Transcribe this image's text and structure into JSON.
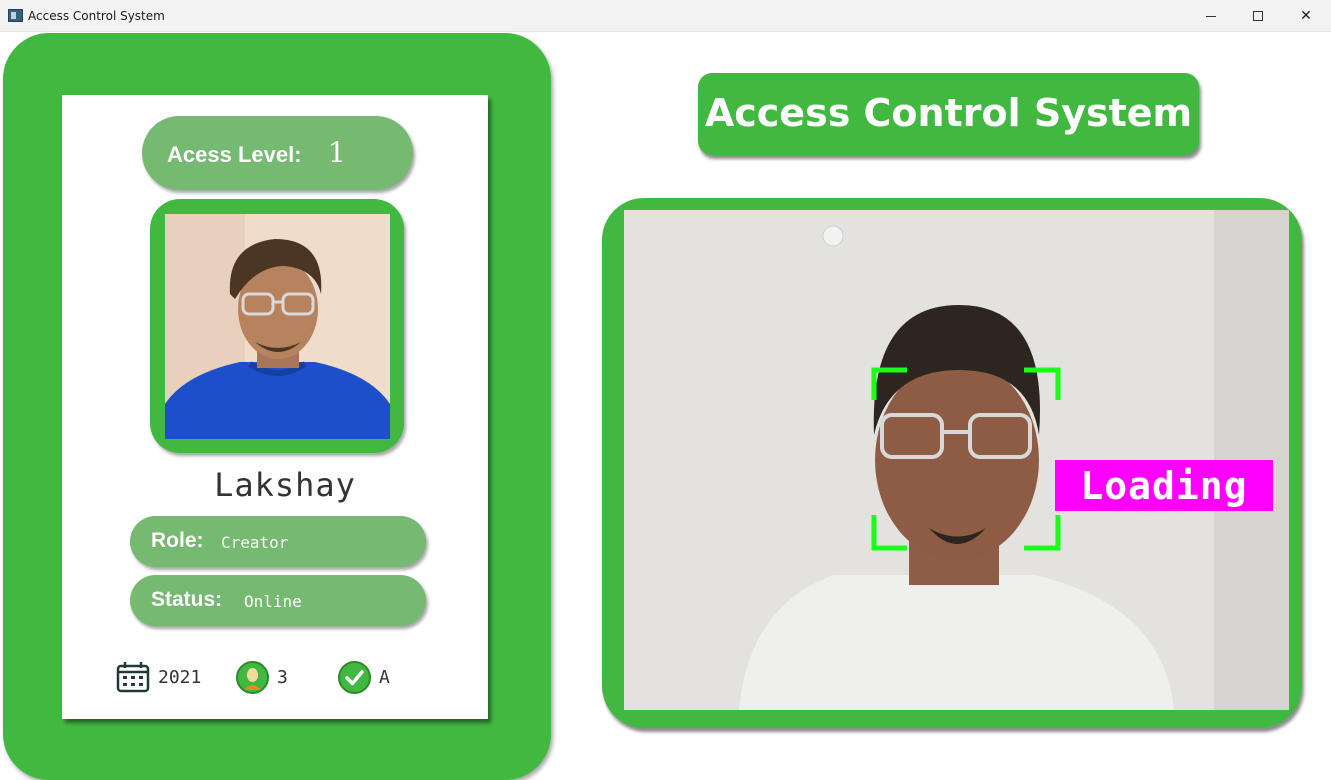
{
  "window": {
    "title": "Access Control System",
    "controls": {
      "minimize": "minimize",
      "maximize": "maximize",
      "close": "✕"
    }
  },
  "card": {
    "access_level_label": "Acess Level:",
    "access_level_value": "1",
    "name": "Lakshay",
    "role_label": "Role:",
    "role_value": "Creator",
    "status_label": "Status:",
    "status_value": "Online",
    "footer": {
      "year": "2021",
      "count": "3",
      "grade": "A"
    }
  },
  "header": {
    "title": "Access Control System"
  },
  "camera": {
    "status_label": "Loading"
  },
  "colors": {
    "primary_green": "#41b941",
    "pill_green": "#76b971",
    "face_box": "#1aff1a",
    "loading_bg": "#ff00ff"
  },
  "icons": [
    "app-icon",
    "calendar-icon",
    "user-badge-icon",
    "check-circle-icon",
    "face-detect-box"
  ]
}
